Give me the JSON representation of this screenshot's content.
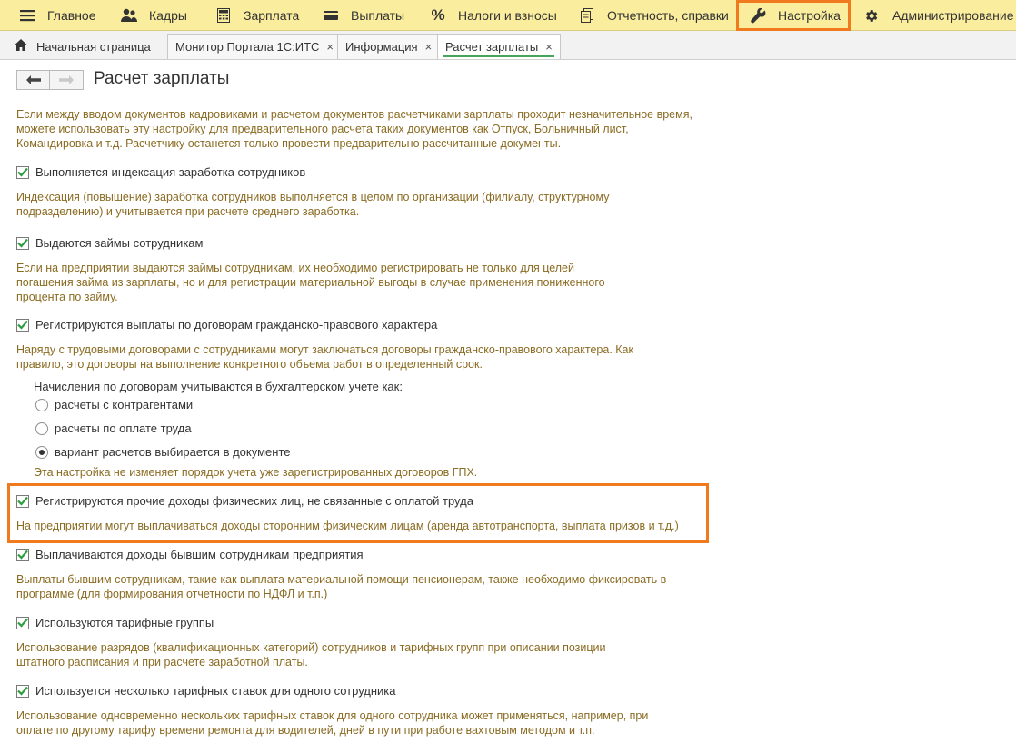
{
  "menu": {
    "items": [
      {
        "label": "Главное",
        "icon": "hamburger-icon"
      },
      {
        "label": "Кадры",
        "icon": "people-icon"
      },
      {
        "label": "Зарплата",
        "icon": "calculator-icon"
      },
      {
        "label": "Выплаты",
        "icon": "wallet-icon"
      },
      {
        "label": "Налоги и взносы",
        "icon": "percent-icon"
      },
      {
        "label": "Отчетность, справки",
        "icon": "reports-icon"
      },
      {
        "label": "Настройка",
        "icon": "wrench-icon"
      },
      {
        "label": "Администрирование",
        "icon": "gear-icon"
      }
    ],
    "highlighted": "Настройка"
  },
  "tabs": [
    {
      "label": "Начальная страница",
      "icon": "home-icon"
    },
    {
      "label": "Монитор Портала 1С:ИТС",
      "close": "×"
    },
    {
      "label": "Информация",
      "close": "×"
    },
    {
      "label": "Расчет зарплаты",
      "close": "×",
      "active": true
    }
  ],
  "page": {
    "title": "Расчет зарплаты",
    "back_icon": "arrow-left-icon",
    "forward_icon": "arrow-right-icon",
    "intro": "Если между вводом документов кадровиками и расчетом документов расчетчиками зарплаты проходит незначительное время, можете использовать эту настройку для предварительного расчета таких документов как Отпуск, Больничный лист, Командировка и т.д. Расчетчику останется только провести предварительно рассчитанные документы."
  },
  "settings": [
    {
      "label": "Выполняется индексация заработка сотрудников",
      "checked": true,
      "desc": "Индексация (повышение) заработка сотрудников выполняется в целом по организации (филиалу, структурному подразделению) и учитывается при расчете среднего заработка."
    },
    {
      "label": "Выдаются займы сотрудникам",
      "checked": true,
      "desc": "Если на предприятии выдаются займы сотрудникам, их необходимо регистрировать не только для целей погашения займа из зарплаты, но и для регистрации материальной выгоды в случае применения пониженного процента по займу."
    },
    {
      "label": "Регистрируются выплаты по договорам гражданско-правового характера",
      "checked": true,
      "desc": "Наряду с трудовыми договорами с сотрудниками могут заключаться договоры гражданско-правового характера. Как правило, это договоры на выполнение конкретного объема работ в определенный срок."
    },
    {
      "label": "Регистрируются прочие доходы физических лиц, не связанные с оплатой труда",
      "checked": true,
      "desc": "На предприятии могут выплачиваться доходы сторонним физическим лицам (аренда автотранспорта, выплата призов и т.д.)"
    },
    {
      "label": "Выплачиваются доходы бывшим сотрудникам предприятия",
      "checked": true,
      "desc": "Выплаты бывшим сотрудникам, такие как выплата материальной помощи пенсионерам, также необходимо фиксировать в программе (для формирования отчетности по НДФЛ и т.п.)"
    },
    {
      "label": "Используются тарифные группы",
      "checked": true,
      "desc": "Использование разрядов (квалификационных категорий) сотрудников и тарифных групп при описании позиции штатного расписания и при расчете заработной платы."
    },
    {
      "label": "Используется несколько тарифных ставок для одного сотрудника",
      "checked": true,
      "desc": "Использование одновременно нескольких тарифных ставок для одного сотрудника может применяться, например, при оплате по другому тарифу времени ремонта для водителей, дней в пути при работе вахтовым методом и т.п."
    }
  ],
  "gph": {
    "label": "Начисления по договорам учитываются в бухгалтерском учете как:",
    "options": [
      {
        "label": "расчеты с контрагентами",
        "selected": false
      },
      {
        "label": "расчеты по оплате труда",
        "selected": false
      },
      {
        "label": "вариант расчетов выбирается в документе",
        "selected": true
      }
    ],
    "note": "Эта настройка не изменяет порядок учета уже зарегистрированных договоров ГПХ."
  },
  "colors": {
    "menu_bg": "#fbed9e",
    "highlight": "#f07a1e",
    "description": "#8a6b22",
    "check": "#2e9e3e"
  }
}
